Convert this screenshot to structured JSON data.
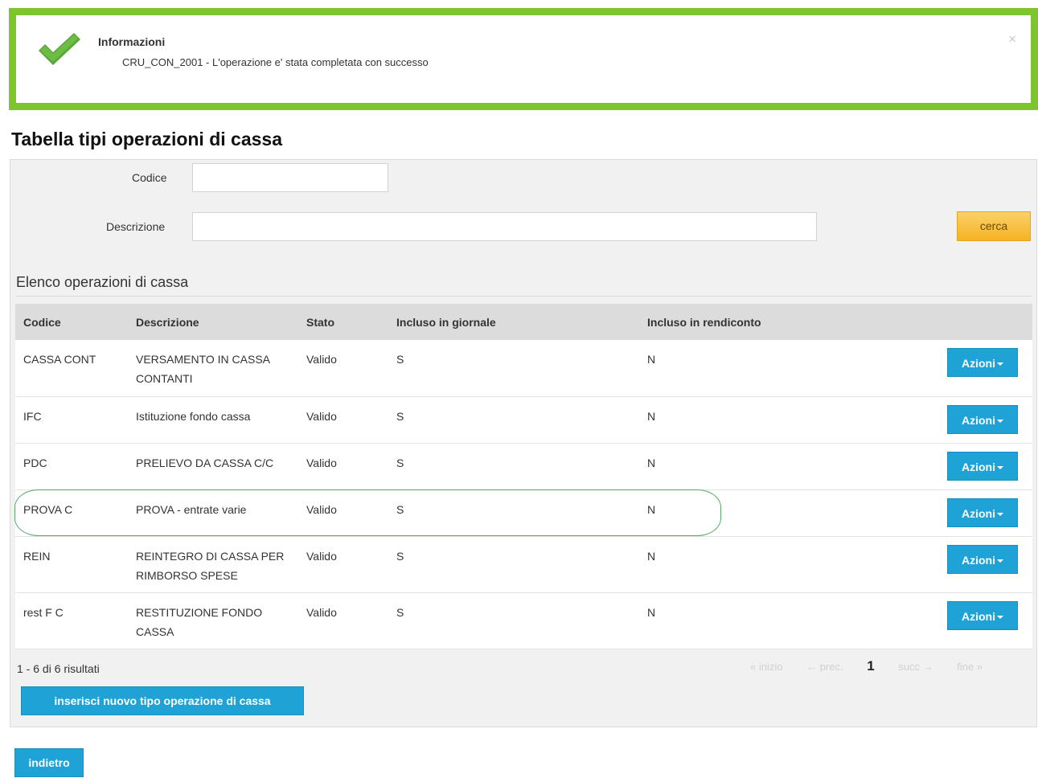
{
  "alert": {
    "title": "Informazioni",
    "message": "CRU_CON_2001 - L'operazione e' stata completata con successo",
    "close": "×",
    "border_color": "#7cc52c",
    "icon": "checkmark-icon"
  },
  "page": {
    "title": "Tabella tipi operazioni di cassa"
  },
  "search": {
    "codice_label": "Codice",
    "codice_value": "",
    "descrizione_label": "Descrizione",
    "descrizione_value": "",
    "button": "cerca"
  },
  "list": {
    "title": "Elenco operazioni di cassa",
    "columns": [
      "Codice",
      "Descrizione",
      "Stato",
      "Incluso in giornale",
      "Incluso in rendiconto"
    ],
    "rows": [
      {
        "codice": "CASSA CONT",
        "descrizione": "VERSAMENTO IN CASSA CONTANTI",
        "stato": "Valido",
        "giornale": "S",
        "rendiconto": "N",
        "azioni": "Azioni"
      },
      {
        "codice": "IFC",
        "descrizione": "Istituzione fondo cassa",
        "stato": "Valido",
        "giornale": "S",
        "rendiconto": "N",
        "azioni": "Azioni"
      },
      {
        "codice": "PDC",
        "descrizione": "PRELIEVO DA CASSA C/C",
        "stato": "Valido",
        "giornale": "S",
        "rendiconto": "N",
        "azioni": "Azioni"
      },
      {
        "codice": "PROVA C",
        "descrizione": "PROVA - entrate varie",
        "stato": "Valido",
        "giornale": "S",
        "rendiconto": "N",
        "azioni": "Azioni"
      },
      {
        "codice": "REIN",
        "descrizione": "REINTEGRO DI CASSA PER RIMBORSO SPESE",
        "stato": "Valido",
        "giornale": "S",
        "rendiconto": "N",
        "azioni": "Azioni"
      },
      {
        "codice": "rest F C",
        "descrizione": "RESTITUZIONE FONDO CASSA",
        "stato": "Valido",
        "giornale": "S",
        "rendiconto": "N",
        "azioni": "Azioni"
      }
    ],
    "results": "1 - 6 di 6 risultati",
    "pager": {
      "first": "« inizio",
      "prev": "← prec.",
      "current": "1",
      "next": "succ →",
      "last": "fine »"
    },
    "new_button": "inserisci nuovo tipo operazione di cassa"
  },
  "back_button": "indietro",
  "colors": {
    "accent_blue": "#1fa3d6",
    "search_yellow": "#f4b321",
    "success_green": "#7cc52c"
  }
}
